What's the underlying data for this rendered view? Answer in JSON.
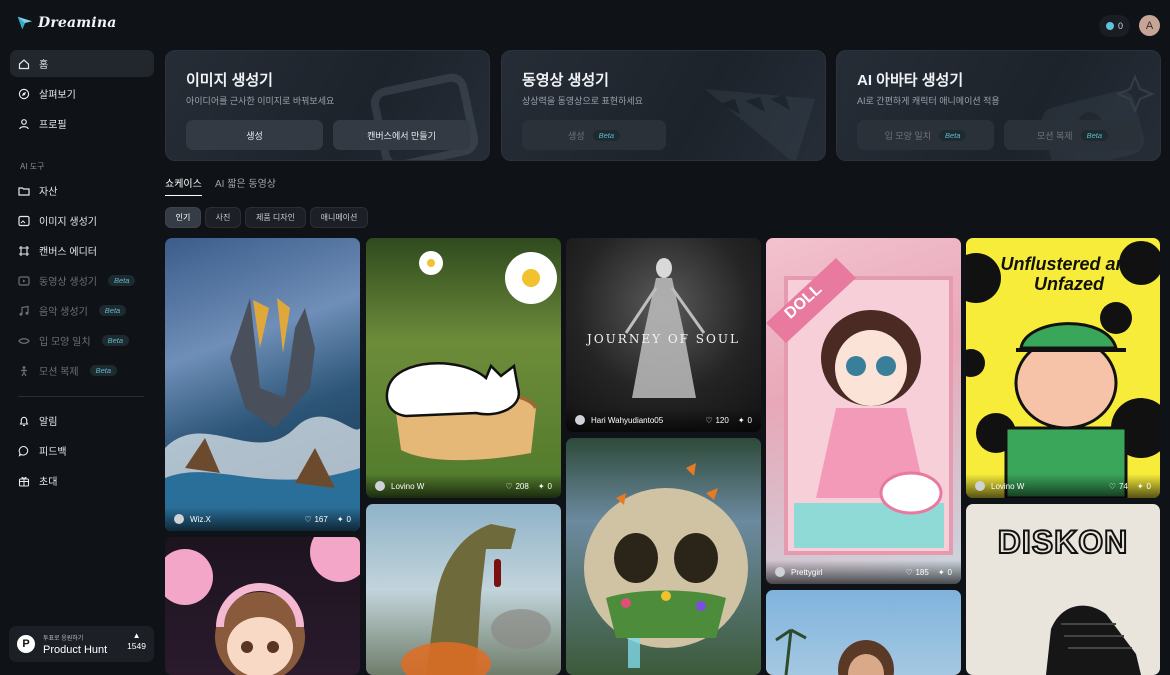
{
  "brand": {
    "name": "Dreamina"
  },
  "topbar": {
    "credits": "0",
    "avatar_initial": "A"
  },
  "sidebar": {
    "primary": [
      {
        "label": "홈",
        "icon": "home-icon"
      },
      {
        "label": "살펴보기",
        "icon": "compass-icon"
      },
      {
        "label": "프로필",
        "icon": "user-icon"
      }
    ],
    "section_label": "AI 도구",
    "tools": [
      {
        "label": "자산",
        "icon": "folder-icon"
      },
      {
        "label": "이미지 생성기",
        "icon": "image-icon"
      },
      {
        "label": "캔버스 에디터",
        "icon": "canvas-icon"
      },
      {
        "label": "동영상 생성기",
        "icon": "video-icon",
        "beta": "Beta"
      },
      {
        "label": "음악 생성기",
        "icon": "music-icon",
        "beta": "Beta"
      },
      {
        "label": "입 모양 일치",
        "icon": "lip-sync-icon",
        "beta": "Beta"
      },
      {
        "label": "모션 복제",
        "icon": "motion-icon",
        "beta": "Beta"
      }
    ],
    "secondary": [
      {
        "label": "알림",
        "icon": "bell-icon"
      },
      {
        "label": "피드백",
        "icon": "feedback-icon"
      },
      {
        "label": "초대",
        "icon": "invite-icon"
      }
    ],
    "product_hunt": {
      "small": "투표로 응원하기",
      "name": "Product Hunt",
      "count": "1549"
    }
  },
  "cards": [
    {
      "title": "이미지 생성기",
      "subtitle": "아이디어를 근사한 이미지로 바꿔보세요",
      "buttons": [
        {
          "label": "생성"
        },
        {
          "label": "캔버스에서 만들기"
        }
      ]
    },
    {
      "title": "동영상 생성기",
      "subtitle": "상상력을 동영상으로 표현하세요",
      "buttons": [
        {
          "label": "생성",
          "beta": "Beta"
        }
      ]
    },
    {
      "title": "AI 아바타 생성기",
      "subtitle": "AI로 간편하게 캐릭터 애니메이션 적용",
      "buttons": [
        {
          "label": "입 모양 일치",
          "beta": "Beta"
        },
        {
          "label": "모션 복제",
          "beta": "Beta"
        }
      ]
    }
  ],
  "tabs": [
    {
      "label": "쇼케이스"
    },
    {
      "label": "AI 짧은 동영상"
    }
  ],
  "filters": [
    {
      "label": "인기"
    },
    {
      "label": "사진"
    },
    {
      "label": "제품 디자인"
    },
    {
      "label": "애니메이션"
    }
  ],
  "gallery": [
    {
      "user": "Wiz.X",
      "likes": "167",
      "remixes": "0"
    },
    {
      "user": "Lovino W",
      "likes": "208",
      "remixes": "0"
    },
    {
      "user": "Hari Wahyudianto05",
      "likes": "120",
      "remixes": "0",
      "art_text": "JOURNEY OF SOUL"
    },
    {
      "user": "Prettygirl",
      "likes": "185",
      "remixes": "0",
      "art_text": "DOLL"
    },
    {
      "user": "Lovino W",
      "likes": "74",
      "remixes": "0",
      "art_text": "Unflustered and Unfazed"
    },
    {
      "art_text": "DISKON"
    }
  ]
}
